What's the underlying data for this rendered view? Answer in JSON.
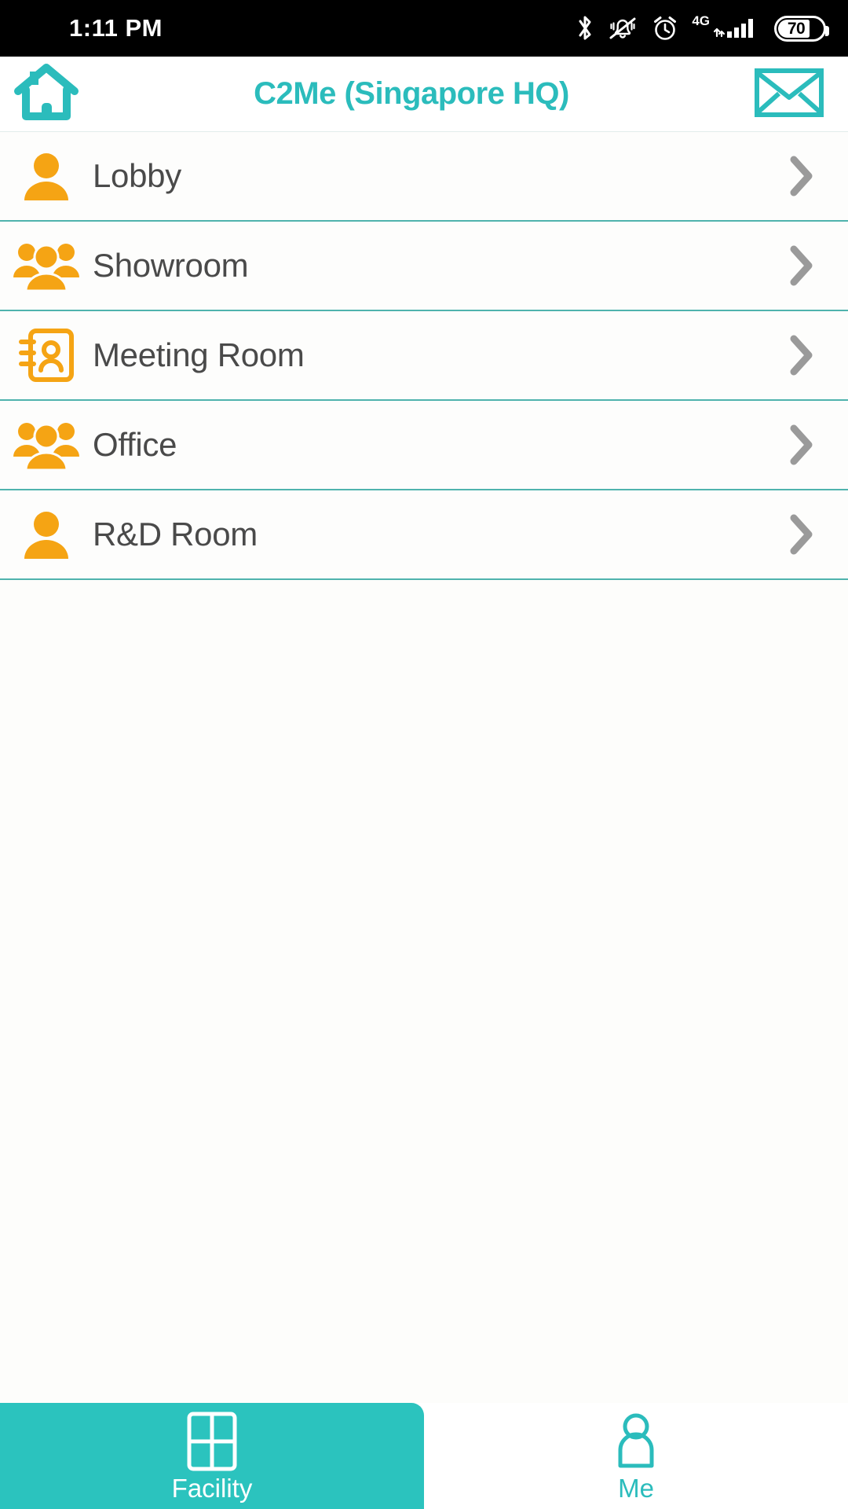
{
  "status_bar": {
    "time": "1:11 PM",
    "network_label": "4G",
    "battery_level": "70",
    "icons": [
      "bluetooth-icon",
      "bell-muted-icon",
      "alarm-clock-icon",
      "signal-bars-icon",
      "battery-icon"
    ]
  },
  "header": {
    "title": "C2Me (Singapore HQ)",
    "home_icon": "home-icon",
    "mail_icon": "envelope-icon"
  },
  "colors": {
    "accent_teal": "#2bbcbc",
    "tab_active_teal": "#2bc3be",
    "icon_orange": "#f5a414",
    "divider_teal": "#4fb3ad",
    "row_text": "#4a4a4a",
    "chevron_gray": "#9a9a9a",
    "status_bar_bg": "#000000"
  },
  "facility_list": [
    {
      "label": "Lobby",
      "icon": "person-icon",
      "chevron": "chevron-right-icon"
    },
    {
      "label": "Showroom",
      "icon": "people-group-icon",
      "chevron": "chevron-right-icon"
    },
    {
      "label": "Meeting Room",
      "icon": "contact-book-icon",
      "chevron": "chevron-right-icon"
    },
    {
      "label": "Office",
      "icon": "people-group-icon",
      "chevron": "chevron-right-icon"
    },
    {
      "label": "R&D Room",
      "icon": "person-icon",
      "chevron": "chevron-right-icon"
    }
  ],
  "bottom_nav": {
    "tabs": [
      {
        "label": "Facility",
        "icon": "grid-squares-icon",
        "active": true
      },
      {
        "label": "Me",
        "icon": "person-outline-icon",
        "active": false
      }
    ]
  }
}
